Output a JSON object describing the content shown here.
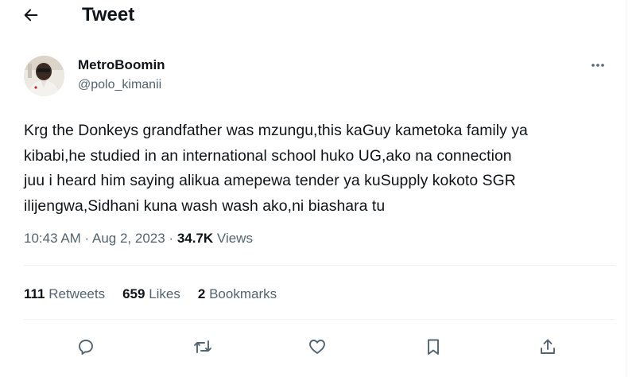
{
  "header": {
    "title": "Tweet",
    "back_icon": "arrow-left-icon"
  },
  "author": {
    "name": "MetroBoomin",
    "handle": "@polo_kimanii",
    "more_icon": "ellipsis-icon"
  },
  "tweet": {
    "lines": [
      "Krg the Donkeys grandfather was mzungu,this kaGuy kametoka family ya",
      "kibabi,he studied in an international school huko UG,ako na connection",
      "juu i heard him saying alikua amepewa tender ya kuSupply kokoto SGR",
      "ilijengwa,Sidhani kuna wash wash ako,ni biashara tu"
    ]
  },
  "meta": {
    "time": "10:43 AM",
    "sep1": " · ",
    "date": "Aug 2, 2023",
    "sep2": " · ",
    "views_count": "34.7K",
    "views_label": " Views"
  },
  "stats": {
    "retweets_count": "111",
    "retweets_label": " Retweets",
    "likes_count": "659",
    "likes_label": " Likes",
    "bookmarks_count": "2",
    "bookmarks_label": " Bookmarks"
  },
  "actions": [
    "reply-icon",
    "retweet-icon",
    "like-icon",
    "bookmark-icon",
    "share-icon"
  ],
  "colors": {
    "text": "#0f1419",
    "secondary": "#536471",
    "divider": "#eff3f4"
  }
}
